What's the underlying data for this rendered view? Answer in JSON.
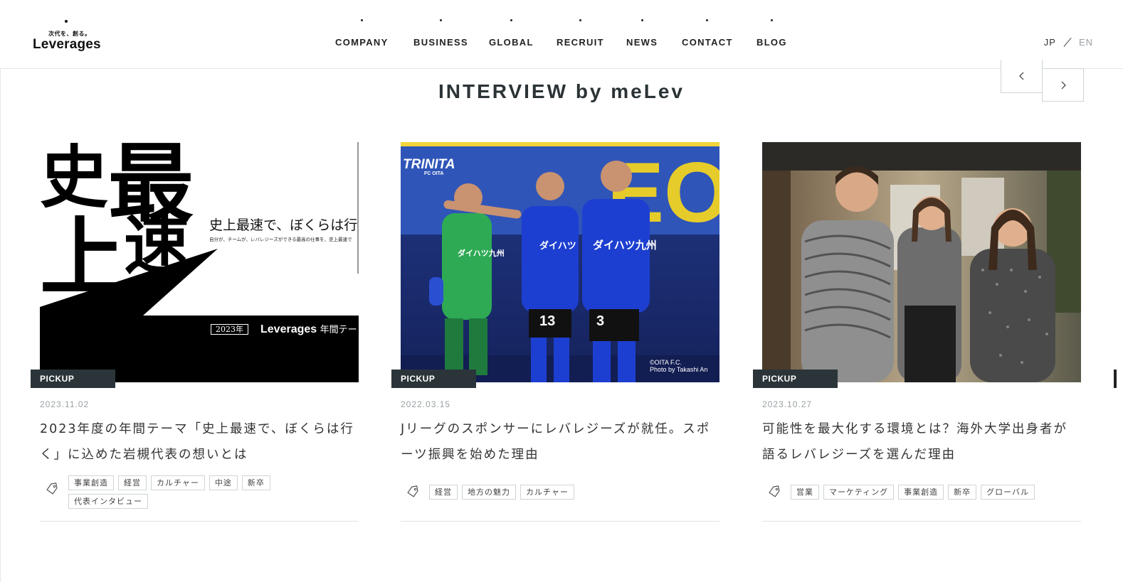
{
  "header": {
    "logo_tagline": "次代を、創る。",
    "logo_word": "Leverages",
    "nav": [
      "COMPANY",
      "BUSINESS",
      "GLOBAL",
      "RECRUIT",
      "NEWS",
      "CONTACT",
      "BLOG"
    ],
    "lang_jp": "JP",
    "lang_en": "EN"
  },
  "section": {
    "title": "INTERVIEW by meLev"
  },
  "cards": [
    {
      "badge": "PICKUP",
      "date": "2023.11.02",
      "title": "2023年度の年間テーマ「史上最速で、ぼくらは行く」に込めた岩槻代表の想いとは",
      "tags": [
        "事業創造",
        "経営",
        "カルチャー",
        "中途",
        "新卒",
        "代表インタビュー"
      ],
      "thumb": {
        "big1": "史",
        "big2": "最",
        "big3": "上",
        "big4": "速",
        "headline": "史上最速で、ぼくらは行",
        "subline": "自分が、チームが、レバレジーズができる最高の仕事を、史上最速で",
        "year": "2023年",
        "brand": "Leverages",
        "brand_suffix": "年間テー"
      }
    },
    {
      "badge": "PICKUP",
      "date": "2022.03.15",
      "title": "Jリーグのスポンサーにレバレジーズが就任。スポーツ振興を始めた理由",
      "tags": [
        "経営",
        "地方の魅力",
        "カルチャー"
      ],
      "thumb": {
        "team": "TRINITA",
        "team_sub": "FC OITA",
        "credit1": "©OITA F.C.",
        "credit2": "Photo by Takashi An"
      }
    },
    {
      "badge": "PICKUP",
      "date": "2023.10.27",
      "title": "可能性を最大化する環境とは？海外大学出身者が語るレバレジーズを選んだ理由",
      "tags": [
        "営業",
        "マーケティング",
        "事業創造",
        "新卒",
        "グローバル"
      ]
    }
  ]
}
